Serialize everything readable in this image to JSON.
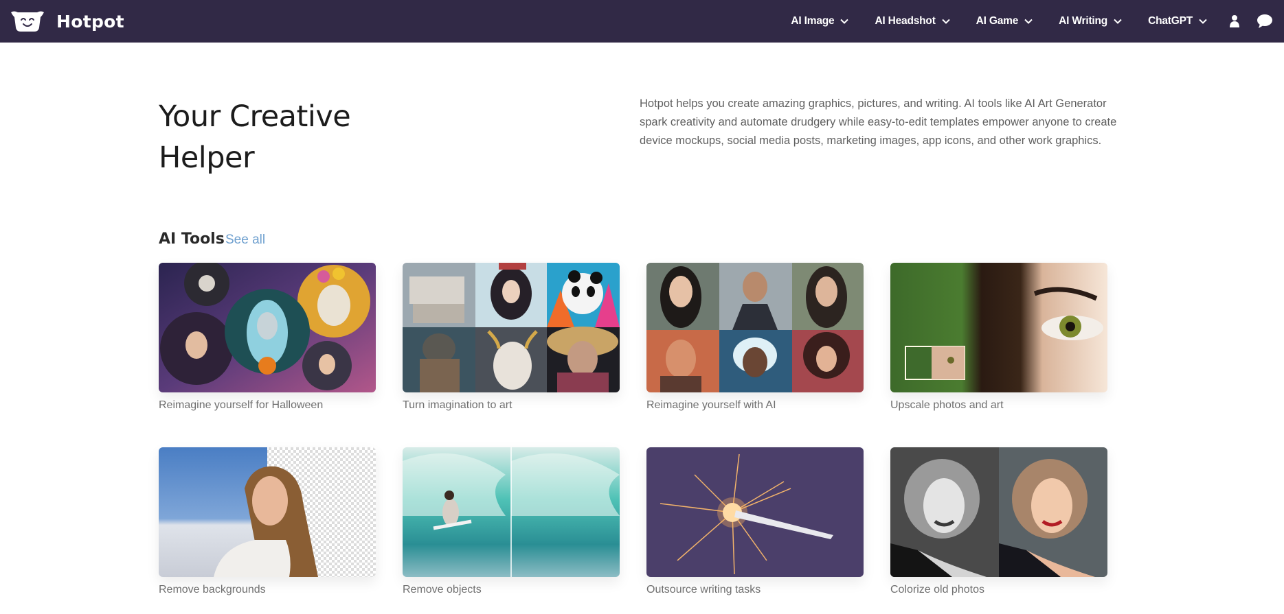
{
  "brand": {
    "name": "Hotpot",
    "logo_icon": "smiling-pot-logo"
  },
  "nav": {
    "items": [
      {
        "label": "AI Image",
        "has_dropdown": true
      },
      {
        "label": "AI Headshot",
        "has_dropdown": true
      },
      {
        "label": "AI Game",
        "has_dropdown": true
      },
      {
        "label": "AI Writing",
        "has_dropdown": true
      },
      {
        "label": "ChatGPT",
        "has_dropdown": true
      }
    ],
    "icons": [
      "user-icon",
      "chat-bubble-icon"
    ]
  },
  "hero": {
    "title_line1": "Your Creative",
    "title_line2": "Helper",
    "description": "Hotpot helps you create amazing graphics, pictures, and writing. AI tools like AI Art Generator spark creativity and automate drudgery while easy-to-edit templates empower anyone to create device mockups, social media posts, marketing images, app icons, and other work graphics."
  },
  "tools_section": {
    "title": "AI Tools",
    "see_all_label": "See all",
    "cards": [
      {
        "label": "Reimagine yourself for Halloween",
        "image": "halloween-portraits"
      },
      {
        "label": "Turn imagination to art",
        "image": "ai-art-collage"
      },
      {
        "label": "Reimagine yourself with AI",
        "image": "ai-headshots-collage"
      },
      {
        "label": "Upscale photos and art",
        "image": "upscaled-eye-closeup"
      },
      {
        "label": "Remove backgrounds",
        "image": "woman-background-removed"
      },
      {
        "label": "Remove objects",
        "image": "surfer-wave-removed"
      },
      {
        "label": "Outsource writing tasks",
        "image": "sparkling-pen"
      },
      {
        "label": "Colorize old photos",
        "image": "colorized-portrait"
      }
    ]
  },
  "colors": {
    "topbar_bg": "#312946",
    "link_blue": "#6fa0cf",
    "card_label": "#707070"
  }
}
